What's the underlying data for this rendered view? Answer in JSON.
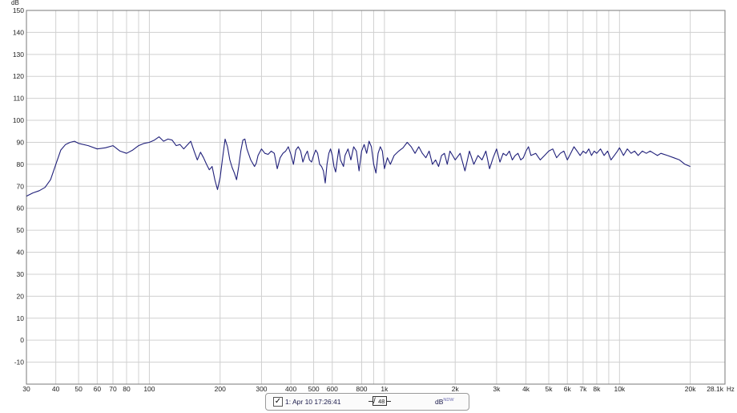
{
  "chart_data": {
    "type": "line",
    "y_unit": "dB",
    "x_unit": "Hz",
    "xlim": [
      30,
      28100
    ],
    "ylim": [
      -20,
      150
    ],
    "x_scale": "log",
    "grid": true,
    "y_ticks": [
      150,
      140,
      130,
      120,
      110,
      100,
      90,
      80,
      70,
      60,
      50,
      40,
      30,
      20,
      10,
      0,
      -10
    ],
    "x_ticks": [
      {
        "v": 30,
        "label": "30"
      },
      {
        "v": 40,
        "label": "40"
      },
      {
        "v": 50,
        "label": "50"
      },
      {
        "v": 60,
        "label": "60"
      },
      {
        "v": 70,
        "label": "70"
      },
      {
        "v": 80,
        "label": "80"
      },
      {
        "v": 100,
        "label": "100"
      },
      {
        "v": 200,
        "label": "200"
      },
      {
        "v": 300,
        "label": "300"
      },
      {
        "v": 400,
        "label": "400"
      },
      {
        "v": 500,
        "label": "500"
      },
      {
        "v": 600,
        "label": "600"
      },
      {
        "v": 800,
        "label": "800"
      },
      {
        "v": 1000,
        "label": "1k"
      },
      {
        "v": 2000,
        "label": "2k"
      },
      {
        "v": 3000,
        "label": "3k"
      },
      {
        "v": 4000,
        "label": "4k"
      },
      {
        "v": 5000,
        "label": "5k"
      },
      {
        "v": 6000,
        "label": "6k"
      },
      {
        "v": 7000,
        "label": "7k"
      },
      {
        "v": 8000,
        "label": "8k"
      },
      {
        "v": 10000,
        "label": "10k"
      },
      {
        "v": 20000,
        "label": "20k"
      },
      {
        "v": 28100,
        "label": "28.1k"
      }
    ],
    "x_minor_grid": [
      90,
      900,
      9000
    ],
    "series": [
      {
        "color": "#20207a",
        "points": [
          [
            30,
            65.5
          ],
          [
            32,
            67
          ],
          [
            34,
            68
          ],
          [
            36,
            69.5
          ],
          [
            38,
            73
          ],
          [
            40,
            80
          ],
          [
            42,
            86.5
          ],
          [
            44,
            89
          ],
          [
            46,
            90
          ],
          [
            48,
            90.5
          ],
          [
            50,
            89.5
          ],
          [
            55,
            88.5
          ],
          [
            60,
            87
          ],
          [
            65,
            87.5
          ],
          [
            70,
            88.5
          ],
          [
            75,
            86
          ],
          [
            80,
            85
          ],
          [
            85,
            86.5
          ],
          [
            90,
            88.5
          ],
          [
            95,
            89.5
          ],
          [
            100,
            90
          ],
          [
            105,
            91
          ],
          [
            110,
            92.5
          ],
          [
            115,
            90.5
          ],
          [
            120,
            91.5
          ],
          [
            125,
            91
          ],
          [
            130,
            88.5
          ],
          [
            135,
            89
          ],
          [
            140,
            87
          ],
          [
            150,
            90.5
          ],
          [
            155,
            86
          ],
          [
            160,
            82
          ],
          [
            165,
            85.5
          ],
          [
            170,
            83
          ],
          [
            175,
            80
          ],
          [
            180,
            77.5
          ],
          [
            185,
            79
          ],
          [
            190,
            73
          ],
          [
            195,
            68.5
          ],
          [
            200,
            74
          ],
          [
            205,
            83
          ],
          [
            210,
            91.5
          ],
          [
            215,
            88
          ],
          [
            220,
            82
          ],
          [
            225,
            78.5
          ],
          [
            230,
            76
          ],
          [
            235,
            73
          ],
          [
            240,
            79
          ],
          [
            245,
            86
          ],
          [
            250,
            91
          ],
          [
            255,
            91.5
          ],
          [
            260,
            87
          ],
          [
            270,
            82
          ],
          [
            280,
            79
          ],
          [
            285,
            80.5
          ],
          [
            290,
            84
          ],
          [
            300,
            87
          ],
          [
            310,
            85
          ],
          [
            320,
            84.5
          ],
          [
            330,
            86
          ],
          [
            340,
            85
          ],
          [
            350,
            78
          ],
          [
            360,
            83
          ],
          [
            370,
            85
          ],
          [
            380,
            86
          ],
          [
            390,
            88
          ],
          [
            400,
            84.5
          ],
          [
            410,
            80
          ],
          [
            420,
            86.5
          ],
          [
            430,
            88
          ],
          [
            440,
            86
          ],
          [
            450,
            81
          ],
          [
            460,
            84
          ],
          [
            470,
            86
          ],
          [
            480,
            82
          ],
          [
            490,
            81
          ],
          [
            500,
            84
          ],
          [
            510,
            86.5
          ],
          [
            520,
            85
          ],
          [
            530,
            80
          ],
          [
            540,
            79
          ],
          [
            550,
            77
          ],
          [
            560,
            71.5
          ],
          [
            570,
            80
          ],
          [
            580,
            85
          ],
          [
            590,
            87
          ],
          [
            600,
            84
          ],
          [
            610,
            79
          ],
          [
            620,
            76.5
          ],
          [
            630,
            82
          ],
          [
            640,
            87
          ],
          [
            650,
            82
          ],
          [
            670,
            79
          ],
          [
            680,
            84
          ],
          [
            700,
            87
          ],
          [
            720,
            82
          ],
          [
            740,
            88
          ],
          [
            760,
            86
          ],
          [
            780,
            77
          ],
          [
            800,
            86
          ],
          [
            820,
            89
          ],
          [
            840,
            85
          ],
          [
            860,
            90.5
          ],
          [
            880,
            88
          ],
          [
            900,
            80
          ],
          [
            920,
            76
          ],
          [
            940,
            85
          ],
          [
            960,
            88
          ],
          [
            980,
            86
          ],
          [
            1000,
            78
          ],
          [
            1030,
            83
          ],
          [
            1060,
            80
          ],
          [
            1100,
            84
          ],
          [
            1150,
            86
          ],
          [
            1200,
            87.5
          ],
          [
            1250,
            90
          ],
          [
            1300,
            88
          ],
          [
            1350,
            85
          ],
          [
            1400,
            88
          ],
          [
            1450,
            85
          ],
          [
            1500,
            83
          ],
          [
            1550,
            86
          ],
          [
            1600,
            80
          ],
          [
            1650,
            82
          ],
          [
            1700,
            79
          ],
          [
            1750,
            84
          ],
          [
            1800,
            85
          ],
          [
            1850,
            80
          ],
          [
            1900,
            86
          ],
          [
            1950,
            84
          ],
          [
            2000,
            82
          ],
          [
            2100,
            85
          ],
          [
            2200,
            77
          ],
          [
            2300,
            86
          ],
          [
            2400,
            80
          ],
          [
            2500,
            84
          ],
          [
            2600,
            82
          ],
          [
            2700,
            86
          ],
          [
            2800,
            78
          ],
          [
            2900,
            83
          ],
          [
            3000,
            87
          ],
          [
            3100,
            81
          ],
          [
            3200,
            85
          ],
          [
            3300,
            84
          ],
          [
            3400,
            86
          ],
          [
            3500,
            82
          ],
          [
            3600,
            84
          ],
          [
            3700,
            85
          ],
          [
            3800,
            82
          ],
          [
            3900,
            83
          ],
          [
            4000,
            86
          ],
          [
            4100,
            88
          ],
          [
            4200,
            84
          ],
          [
            4400,
            85
          ],
          [
            4600,
            82
          ],
          [
            4800,
            84
          ],
          [
            5000,
            86
          ],
          [
            5200,
            87
          ],
          [
            5400,
            83
          ],
          [
            5600,
            85
          ],
          [
            5800,
            86
          ],
          [
            6000,
            82
          ],
          [
            6200,
            85
          ],
          [
            6400,
            88
          ],
          [
            6600,
            86
          ],
          [
            6800,
            84
          ],
          [
            7000,
            86
          ],
          [
            7200,
            85
          ],
          [
            7400,
            87
          ],
          [
            7600,
            84
          ],
          [
            7800,
            86
          ],
          [
            8000,
            85
          ],
          [
            8300,
            87
          ],
          [
            8600,
            84
          ],
          [
            8900,
            86
          ],
          [
            9200,
            82
          ],
          [
            9500,
            84
          ],
          [
            9800,
            86
          ],
          [
            10000,
            87.5
          ],
          [
            10400,
            84
          ],
          [
            10800,
            87
          ],
          [
            11200,
            85
          ],
          [
            11600,
            86
          ],
          [
            12000,
            84
          ],
          [
            12500,
            86
          ],
          [
            13000,
            85
          ],
          [
            13500,
            86
          ],
          [
            14000,
            85
          ],
          [
            14500,
            84
          ],
          [
            15000,
            85
          ],
          [
            16000,
            84
          ],
          [
            17000,
            83
          ],
          [
            18000,
            82
          ],
          [
            19000,
            80
          ],
          [
            20000,
            79
          ]
        ]
      }
    ]
  },
  "legend": {
    "checked_glyph": "✓",
    "label": "1: Apr 10 17:26:41",
    "smoothing": "48",
    "unit": "dB",
    "unit_sup": "NDW"
  }
}
